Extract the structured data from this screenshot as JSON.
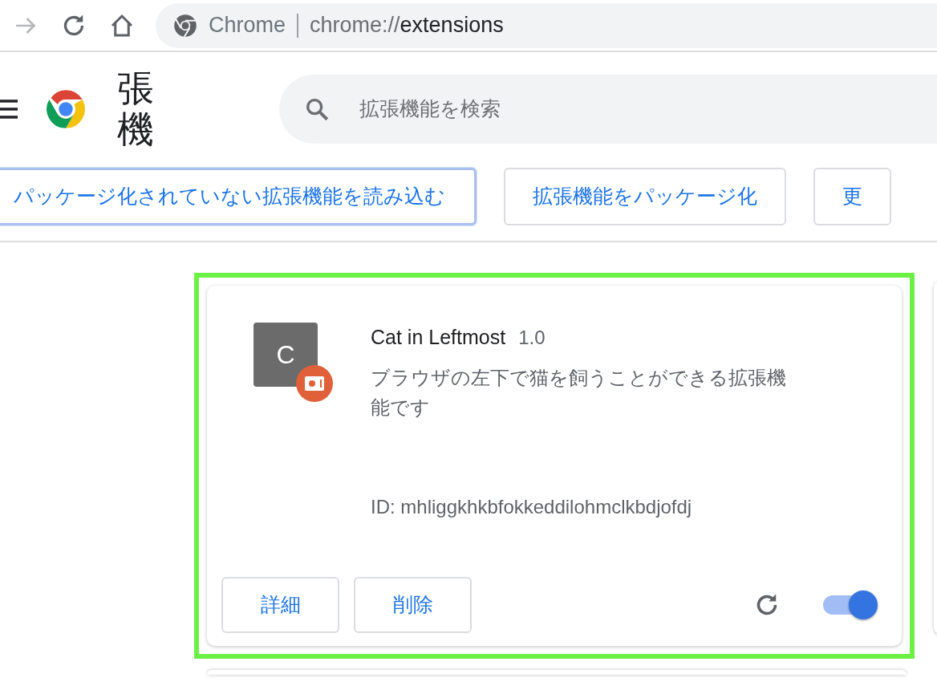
{
  "toolbar": {
    "forward_disabled": true
  },
  "omnibox": {
    "chip": "Chrome",
    "url_scheme": "chrome://",
    "url_host": "extensions"
  },
  "header": {
    "title": "張機",
    "search": {
      "placeholder": "拡張機能を検索"
    }
  },
  "actions": [
    {
      "label": "パッケージ化されていない拡張機能を読み込む",
      "focused": true
    },
    {
      "label": "拡張機能をパッケージ化",
      "focused": false
    },
    {
      "label": "更",
      "focused": false
    }
  ],
  "extension": {
    "highlighted": true,
    "icon_letter": "C",
    "name": "Cat in Leftmost",
    "version": "1.0",
    "description": "ブラウザの左下で猫を飼うことができる拡張機能です",
    "id": "ID: mhliggkhkbfokkeddilohmclkbdjofdj",
    "buttons": [
      "詳細",
      "削除"
    ],
    "enabled": true
  }
}
